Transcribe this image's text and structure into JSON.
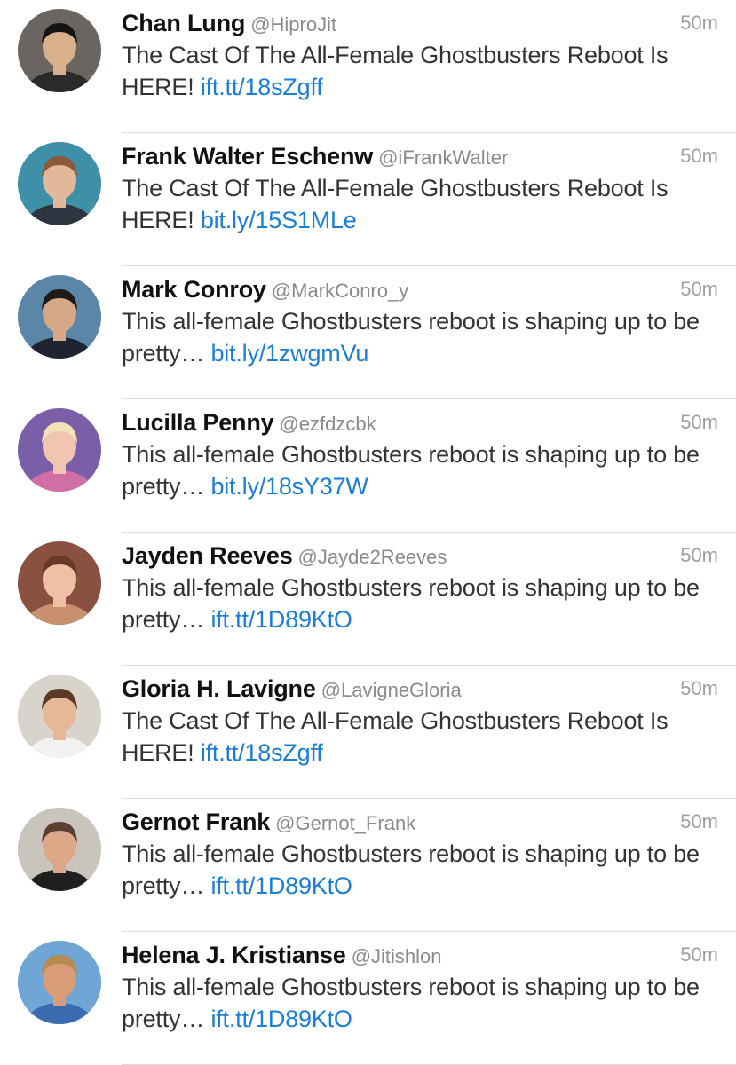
{
  "tweets": [
    {
      "name": "Chan Lung",
      "handle": "@HiproJit",
      "time": "50m",
      "text": "The Cast Of The All-Female Ghostbusters Reboot Is HERE! ",
      "link": "ift.tt/18sZgff",
      "avatar": {
        "bg": "#6a6560",
        "skin": "#d9b08c",
        "hair": "#141414",
        "shirt": "#2a2a2a"
      }
    },
    {
      "name": "Frank Walter Eschenw",
      "handle": "@iFrankWalter",
      "time": "50m",
      "text": "The Cast Of The All-Female Ghostbusters Reboot Is HERE! ",
      "link": "bit.ly/15S1MLe",
      "avatar": {
        "bg": "#3e8fa8",
        "skin": "#e2b89a",
        "hair": "#8a5a3a",
        "shirt": "#2e3440"
      }
    },
    {
      "name": "Mark Conroy",
      "handle": "@MarkConro_y",
      "time": "50m",
      "text": "This all-female Ghostbusters reboot is shaping up to be pretty… ",
      "link": "bit.ly/1zwgmVu",
      "avatar": {
        "bg": "#5b86a8",
        "skin": "#d7a888",
        "hair": "#1e1a18",
        "shirt": "#1f2430"
      }
    },
    {
      "name": "Lucilla Penny",
      "handle": "@ezfdzcbk",
      "time": "50m",
      "text": "This all-female Ghostbusters reboot is shaping up to be pretty… ",
      "link": "bit.ly/18sY37W",
      "avatar": {
        "bg": "#7a5fa8",
        "skin": "#f0c6b0",
        "hair": "#f2e2b8",
        "shirt": "#d06fa6"
      }
    },
    {
      "name": "Jayden Reeves",
      "handle": "@Jayde2Reeves",
      "time": "50m",
      "text": "This all-female Ghostbusters reboot is shaping up to be pretty… ",
      "link": "ift.tt/1D89KtO",
      "avatar": {
        "bg": "#8a5040",
        "skin": "#f0c0a4",
        "hair": "#6a3a28",
        "shirt": "#c8906c"
      }
    },
    {
      "name": "Gloria H. Lavigne",
      "handle": "@LavigneGloria",
      "time": "50m",
      "text": "The Cast Of The All-Female Ghostbusters Reboot Is HERE! ",
      "link": "ift.tt/18sZgff",
      "avatar": {
        "bg": "#d8d4cc",
        "skin": "#e6b898",
        "hair": "#5a3a24",
        "shirt": "#f2f2f2"
      }
    },
    {
      "name": "Gernot Frank",
      "handle": "@Gernot_Frank",
      "time": "50m",
      "text": "This all-female Ghostbusters reboot is shaping up to be pretty… ",
      "link": "ift.tt/1D89KtO",
      "avatar": {
        "bg": "#c9c4bc",
        "skin": "#dca888",
        "hair": "#5a4030",
        "shirt": "#1f1f1f"
      }
    },
    {
      "name": "Helena J. Kristianse",
      "handle": "@Jitishlon",
      "time": "50m",
      "text": "This all-female Ghostbusters reboot is shaping up to be pretty… ",
      "link": "ift.tt/1D89KtO",
      "avatar": {
        "bg": "#6fa6d6",
        "skin": "#d89c78",
        "hair": "#b88a50",
        "shirt": "#3a6ab0"
      }
    }
  ]
}
